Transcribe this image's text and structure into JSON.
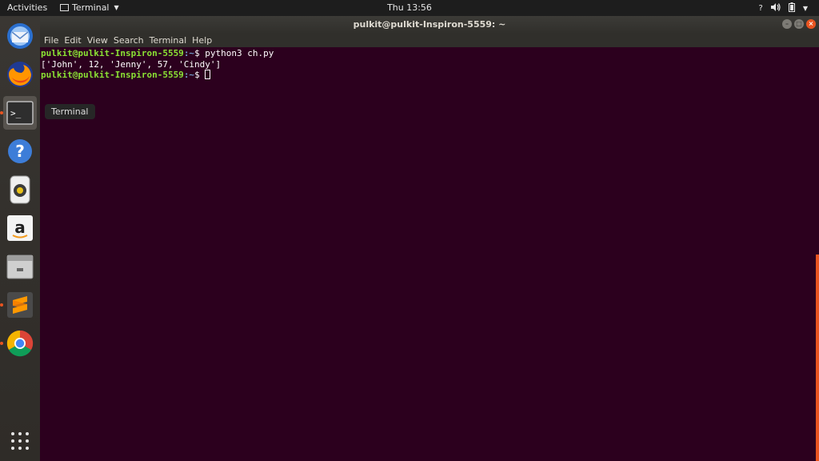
{
  "topbar": {
    "activities": "Activities",
    "app_name": "Terminal",
    "clock": "Thu 13:56",
    "tray_help": "?"
  },
  "window": {
    "title": "pulkit@pulkit-Inspiron-5559: ~"
  },
  "menu": [
    "File",
    "Edit",
    "View",
    "Search",
    "Terminal",
    "Help"
  ],
  "terminal": {
    "line1_prompt": "pulkit@pulkit-Inspiron-5559",
    "line1_path": ":~",
    "line1_cmd": "$ python3 ch.py",
    "line2_output": "['John', 12, 'Jenny', 57, 'Cindy']",
    "line3_prompt": "pulkit@pulkit-Inspiron-5559",
    "line3_path": ":~",
    "line3_cmd": "$ "
  },
  "tooltip": "Terminal",
  "dock": {
    "items": [
      "thunderbird-icon",
      "firefox-icon",
      "terminal-icon",
      "help-icon",
      "rhythmbox-icon",
      "amazon-icon",
      "files-icon",
      "sublime-text-icon",
      "chrome-icon",
      "app-grid-icon"
    ]
  },
  "colors": {
    "terminal_bg": "#2c001e",
    "prompt_green": "#8ae234",
    "path_blue": "#729fcf",
    "accent_orange": "#e95420"
  }
}
